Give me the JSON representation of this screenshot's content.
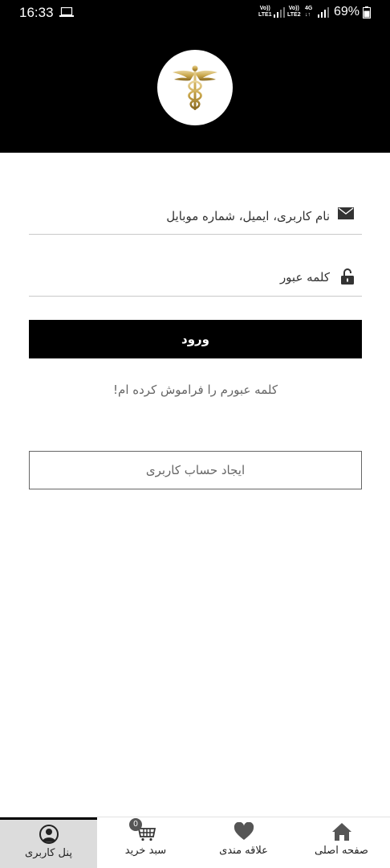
{
  "status_bar": {
    "time": "16:33",
    "sim1_label": "Vo)) LTE1",
    "sim2_label": "Vo)) LTE2",
    "network": "4G",
    "battery": "69%"
  },
  "header": {
    "logo_icon": "caduceus-icon"
  },
  "login_form": {
    "username_placeholder": "نام کاربری، ایمیل، شماره موبایل",
    "password_placeholder": "کلمه عبور",
    "login_button": "ورود",
    "forgot_password": "کلمه عبورم را فراموش کرده ام!",
    "register_button": "ایجاد حساب کاربری"
  },
  "bottom_nav": {
    "items": [
      {
        "label": "پنل کاربری",
        "icon": "user-icon",
        "active": true
      },
      {
        "label": "سبد خرید",
        "icon": "cart-icon",
        "badge": "0"
      },
      {
        "label": "علاقه مندی",
        "icon": "heart-icon"
      },
      {
        "label": "صفحه اصلی",
        "icon": "home-icon"
      }
    ]
  },
  "colors": {
    "header_bg": "#000000",
    "button_bg": "#000000",
    "logo_gold": "#c9a64a",
    "active_tab_bg": "#dcdcdc"
  }
}
